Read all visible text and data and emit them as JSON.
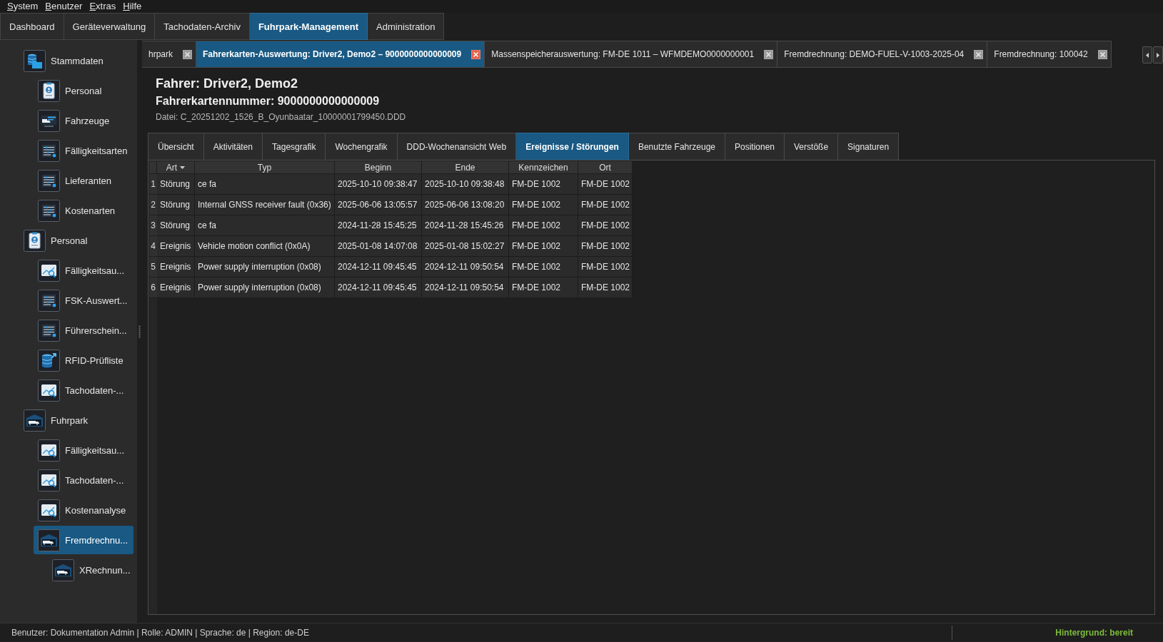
{
  "menu": [
    "System",
    "Benutzer",
    "Extras",
    "Hilfe"
  ],
  "main_tabs": [
    {
      "label": "Dashboard",
      "selected": false
    },
    {
      "label": "Geräteverwaltung",
      "selected": false
    },
    {
      "label": "Tachodaten-Archiv",
      "selected": false
    },
    {
      "label": "Fuhrpark-Management",
      "selected": true
    },
    {
      "label": "Administration",
      "selected": false
    }
  ],
  "sidebar": {
    "items": [
      {
        "label": "Stammdaten",
        "kind": "data",
        "selected": false,
        "children": [
          {
            "label": "Personal",
            "kind": "staff",
            "selected": false
          },
          {
            "label": "Fahrzeuge",
            "kind": "vehicles",
            "selected": false
          },
          {
            "label": "Fälligkeitsarten",
            "kind": "list",
            "selected": false
          },
          {
            "label": "Lieferanten",
            "kind": "list",
            "selected": false
          },
          {
            "label": "Kostenarten",
            "kind": "list",
            "selected": false
          }
        ]
      },
      {
        "label": "Personal",
        "kind": "staff",
        "selected": false,
        "children": [
          {
            "label": "Fälligkeitsau...",
            "kind": "chart",
            "selected": false
          },
          {
            "label": "FSK-Auswert...",
            "kind": "list",
            "selected": false
          },
          {
            "label": "Führerschein...",
            "kind": "list",
            "selected": false
          },
          {
            "label": "RFID-Prüfliste",
            "kind": "export",
            "selected": false
          },
          {
            "label": "Tachodaten-...",
            "kind": "chart",
            "selected": false
          }
        ]
      },
      {
        "label": "Fuhrpark",
        "kind": "fleet",
        "selected": false,
        "children": [
          {
            "label": "Fälligkeitsau...",
            "kind": "chart",
            "selected": false
          },
          {
            "label": "Tachodaten-...",
            "kind": "chart",
            "selected": false
          },
          {
            "label": "Kostenanalyse",
            "kind": "chart",
            "selected": false
          },
          {
            "label": "Fremdrechnu...",
            "kind": "fleet",
            "selected": true,
            "children": [
              {
                "label": "XRechnun...",
                "kind": "fleet",
                "selected": false
              }
            ]
          }
        ]
      }
    ]
  },
  "document_tabs": [
    {
      "label": "hrpark",
      "selected": false
    },
    {
      "label": "Fahrerkarten-Auswertung: Driver2, Demo2 – 9000000000000009",
      "selected": true
    },
    {
      "label": "Massenspeicherauswertung: FM-DE 1011 – WFMDEMO0000000001",
      "selected": false
    },
    {
      "label": "Fremdrechnung: DEMO-FUEL-V-1003-2025-04",
      "selected": false
    },
    {
      "label": "Fremdrechnung: 100042",
      "selected": false
    }
  ],
  "driver": {
    "title": "Fahrer: Driver2, Demo2",
    "card_number": "Fahrerkartennummer: 9000000000000009",
    "file": "Datei: C_20251202_1526_B_Oyunbaatar_10000001799450.DDD"
  },
  "sub_tabs": [
    {
      "label": "Übersicht",
      "selected": false
    },
    {
      "label": "Aktivitäten",
      "selected": false
    },
    {
      "label": "Tagesgrafik",
      "selected": false
    },
    {
      "label": "Wochengrafik",
      "selected": false
    },
    {
      "label": "DDD-Wochenansicht Web",
      "selected": false
    },
    {
      "label": "Ereignisse / Störungen",
      "selected": true
    },
    {
      "label": "Benutzte Fahrzeuge",
      "selected": false
    },
    {
      "label": "Positionen",
      "selected": false
    },
    {
      "label": "Verstöße",
      "selected": false
    },
    {
      "label": "Signaturen",
      "selected": false
    }
  ],
  "table": {
    "columns": [
      {
        "label": "Art",
        "sorted": true
      },
      {
        "label": "Typ",
        "sorted": false
      },
      {
        "label": "Beginn",
        "sorted": false
      },
      {
        "label": "Ende",
        "sorted": false
      },
      {
        "label": "Kennzeichen",
        "sorted": false
      },
      {
        "label": "Ort",
        "sorted": false
      }
    ],
    "rows": [
      {
        "number": "1",
        "cells": [
          "Störung",
          "ce fa",
          "2025-10-10 09:38:47",
          "2025-10-10 09:38:48",
          "FM-DE 1002",
          "FM-DE 1002"
        ]
      },
      {
        "number": "2",
        "cells": [
          "Störung",
          "Internal GNSS receiver fault (0x36)",
          "2025-06-06 13:05:57",
          "2025-06-06 13:08:20",
          "FM-DE 1002",
          "FM-DE 1002"
        ]
      },
      {
        "number": "3",
        "cells": [
          "Störung",
          "ce fa",
          "2024-11-28 15:45:25",
          "2024-11-28 15:45:26",
          "FM-DE 1002",
          "FM-DE 1002"
        ]
      },
      {
        "number": "4",
        "cells": [
          "Ereignis",
          "Vehicle motion conflict (0x0A)",
          "2025-01-08 14:07:08",
          "2025-01-08 15:02:27",
          "FM-DE 1002",
          "FM-DE 1002"
        ]
      },
      {
        "number": "5",
        "cells": [
          "Ereignis",
          "Power supply interruption (0x08)",
          "2024-12-11 09:45:45",
          "2024-12-11 09:50:54",
          "FM-DE 1002",
          "FM-DE 1002"
        ]
      },
      {
        "number": "6",
        "cells": [
          "Ereignis",
          "Power supply interruption (0x08)",
          "2024-12-11 09:45:45",
          "2024-12-11 09:50:54",
          "FM-DE 1002",
          "FM-DE 1002"
        ]
      }
    ]
  },
  "status_bar": {
    "text": "Benutzer: Dokumentation Admin | Rolle: ADMIN | Sprache: de | Region: de-DE",
    "background_task": "Hintergrund: bereit"
  }
}
